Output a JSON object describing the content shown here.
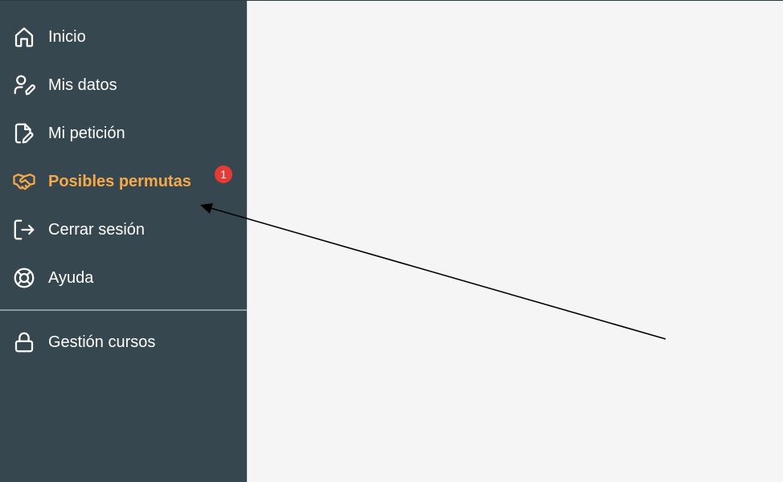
{
  "sidebar": {
    "items": [
      {
        "label": "Inicio",
        "icon": "home-icon"
      },
      {
        "label": "Mis datos",
        "icon": "user-edit-icon"
      },
      {
        "label": "Mi petición",
        "icon": "file-edit-icon"
      },
      {
        "label": "Posibles permutas",
        "icon": "handshake-icon",
        "active": true,
        "badge": "1"
      },
      {
        "label": "Cerrar sesión",
        "icon": "logout-icon"
      },
      {
        "label": "Ayuda",
        "icon": "lifebuoy-icon"
      }
    ],
    "secondary_items": [
      {
        "label": "Gestión cursos",
        "icon": "lock-icon"
      }
    ]
  },
  "colors": {
    "sidebar_bg": "#37474f",
    "main_bg": "#f5f5f5",
    "active": "#f6a94a",
    "badge": "#e63a35",
    "text": "#ffffff"
  }
}
